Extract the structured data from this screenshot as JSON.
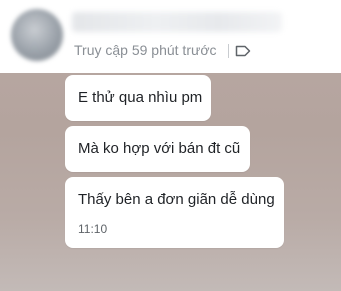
{
  "header": {
    "status_text": "Truy cập 59 phút trước",
    "tag_icon": "tag-icon"
  },
  "messages": [
    {
      "text": "E thử qua nhìu pm",
      "time": ""
    },
    {
      "text": "Mà ko hợp với bán đt cũ",
      "time": ""
    },
    {
      "text": "Thấy bên a đơn giãn dễ dùng",
      "time": "11:10"
    }
  ],
  "colors": {
    "background": "#b8a8a3",
    "bubble": "#ffffff",
    "status_text": "#8a8f95"
  }
}
